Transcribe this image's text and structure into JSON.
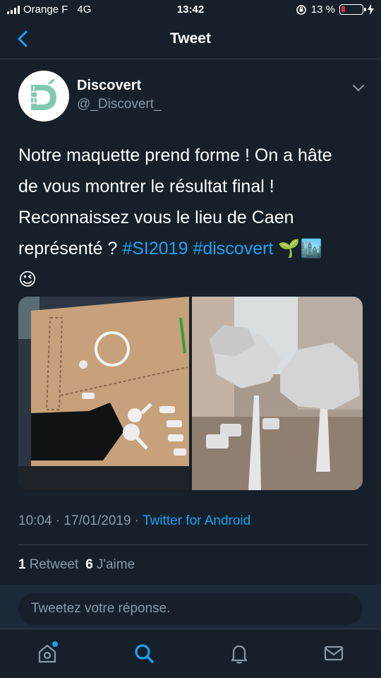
{
  "status_bar": {
    "carrier": "Orange F",
    "network": "4G",
    "time": "13:42",
    "battery_percent": "13 %",
    "battery_level": 0.13
  },
  "header": {
    "title": "Tweet"
  },
  "author": {
    "name": "Discovert",
    "handle": "@_Discovert_"
  },
  "tweet": {
    "text_line1": "Notre maquette prend forme ! On a hâte",
    "text_line2": "de vous montrer le résultat final !",
    "text_line3": "Reconnaissez vous le lieu de Caen",
    "text_line4_prefix": "représenté ? ",
    "hashtag1": "#SI2019",
    "hashtag2": "#discovert",
    "emoji_seedling": "🌱",
    "emoji_city": "🏙️",
    "emoji_wink": "😉",
    "timestamp": "10:04 · 17/01/2019 · ",
    "source": "Twitter for Android"
  },
  "stats": {
    "retweet_count": "1",
    "retweet_label": "Retweet",
    "like_count": "6",
    "like_label": "J'aime"
  },
  "reply": {
    "placeholder": "Tweetez votre réponse."
  },
  "colors": {
    "background": "#15202b",
    "accent": "#1da1f2",
    "secondary_text": "#8899a6",
    "divider": "#38444d",
    "battery_low": "#e0245e"
  },
  "icons": [
    "back-arrow-icon",
    "chevron-down-icon",
    "home-icon",
    "search-icon",
    "bell-icon",
    "mail-icon"
  ]
}
